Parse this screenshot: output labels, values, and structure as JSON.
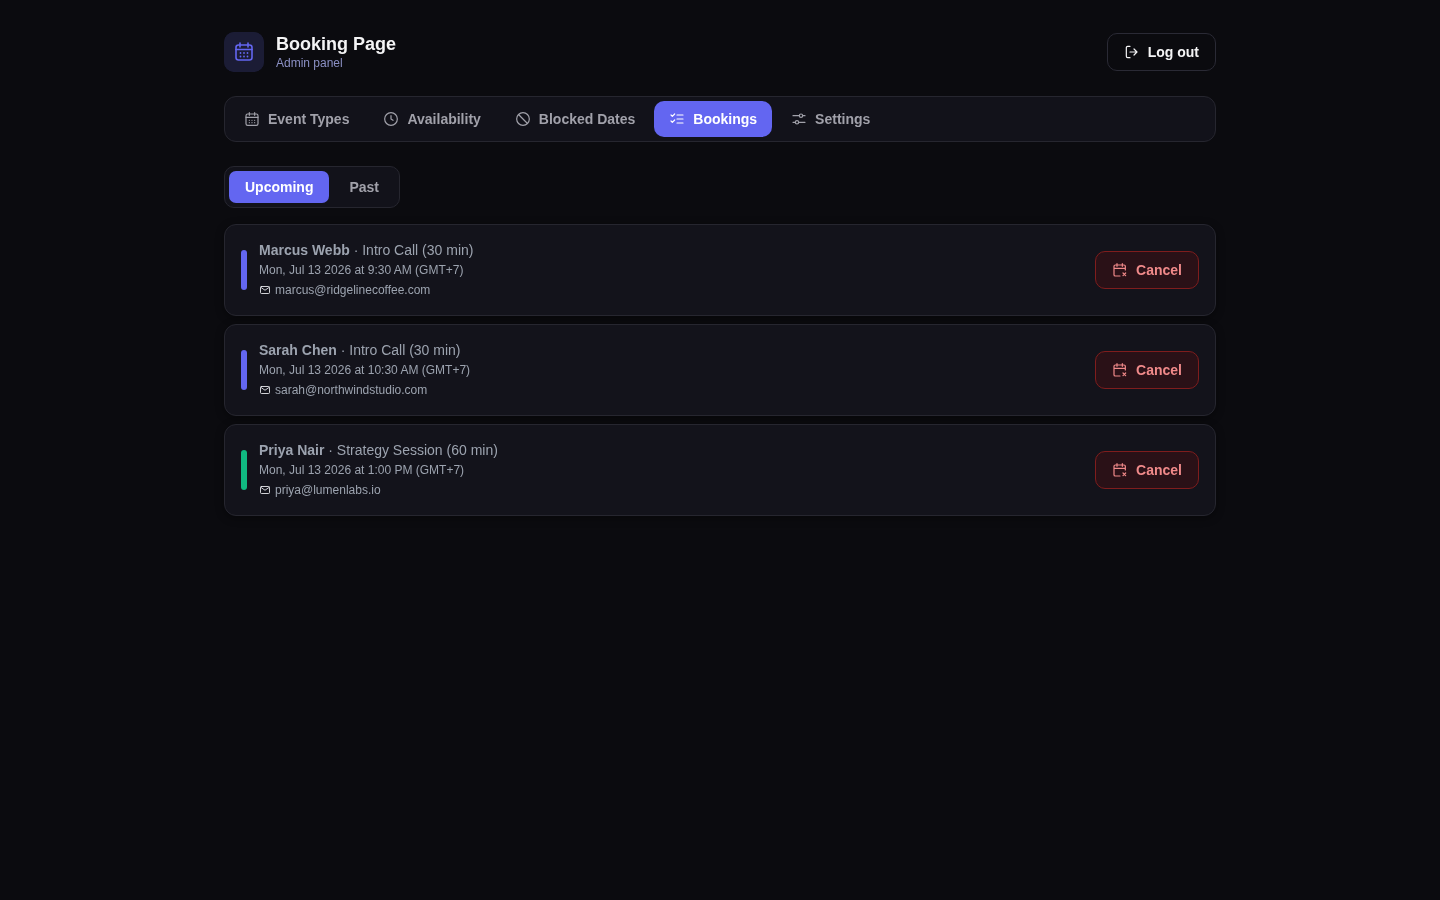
{
  "header": {
    "title": "Booking Page",
    "subtitle": "Admin panel",
    "logout": "Log out"
  },
  "tabs": [
    {
      "label": "Event Types",
      "selected": false
    },
    {
      "label": "Availability",
      "selected": false
    },
    {
      "label": "Blocked Dates",
      "selected": false
    },
    {
      "label": "Bookings",
      "selected": true
    },
    {
      "label": "Settings",
      "selected": false
    }
  ],
  "filters": [
    {
      "label": "Upcoming",
      "selected": true
    },
    {
      "label": "Past",
      "selected": false
    }
  ],
  "bookings": [
    {
      "title": "**Marcus Webb** · Intro Call (30 min)",
      "when": "Mon, Jul 13 2026 at 9:30 AM (GMT+7)",
      "email": "marcus@ridgelinecoffee.com",
      "color": "#6366f1",
      "action": "Cancel"
    },
    {
      "title": "**Sarah Chen** · Intro Call (30 min)",
      "when": "Mon, Jul 13 2026 at 10:30 AM (GMT+7)",
      "email": "sarah@northwindstudio.com",
      "color": "#6366f1",
      "action": "Cancel"
    },
    {
      "title": "**Priya Nair** · Strategy Session (60 min)",
      "when": "Mon, Jul 13 2026 at 1:00 PM (GMT+7)",
      "email": "priya@lumenlabs.io",
      "color": "#10b981",
      "action": "Cancel"
    }
  ]
}
